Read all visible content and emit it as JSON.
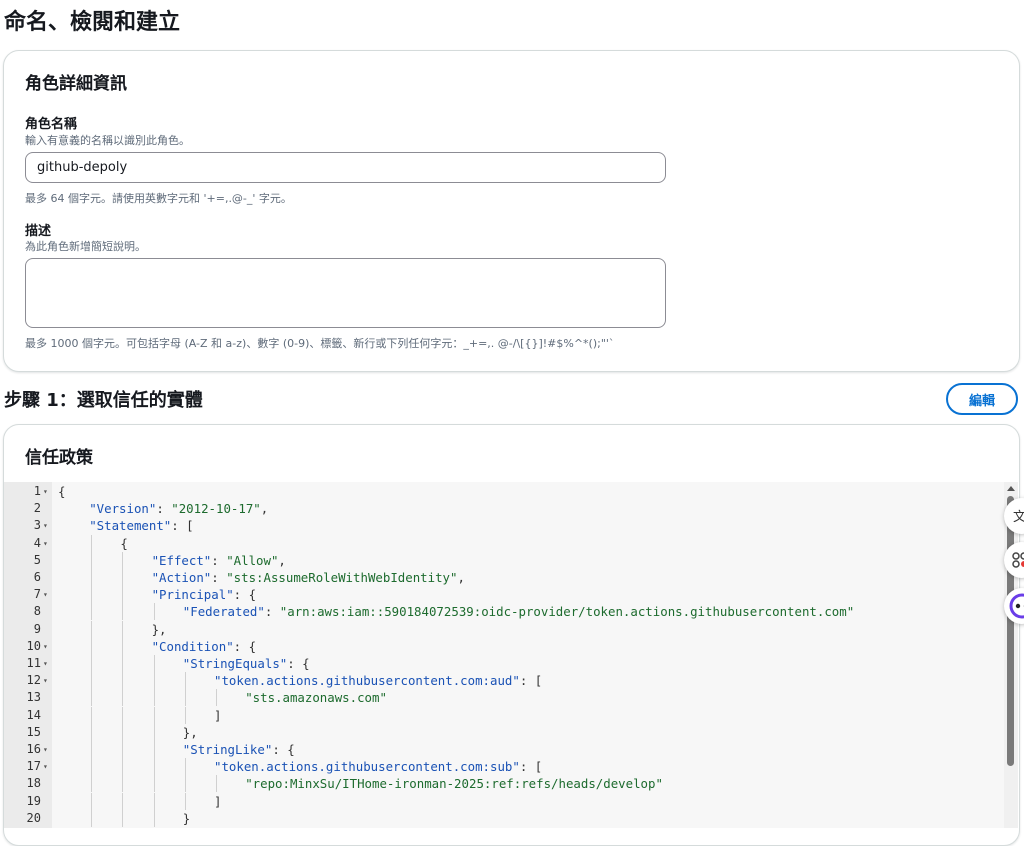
{
  "page_title": "命名、檢閱和建立",
  "role_details": {
    "title": "角色詳細資訊",
    "name_label": "角色名稱",
    "name_desc": "輸入有意義的名稱以識別此角色。",
    "name_value": "github-depoly",
    "name_constraint": "最多 64 個字元。請使用英數字元和 '+=,.@-_' 字元。",
    "desc_label": "描述",
    "desc_desc": "為此角色新增簡短說明。",
    "desc_value": "",
    "desc_constraint": "最多 1000 個字元。可包括字母 (A-Z 和 a-z)、數字 (0-9)、標籤、新行或下列任何字元：_+=,. @-/\\[{}]!#$%^*();\"'`"
  },
  "step1": {
    "heading": "步驟 1：選取信任的實體",
    "edit_label": "編輯"
  },
  "trust_policy": {
    "title": "信任政策",
    "lines": [
      {
        "n": "1",
        "fold": true,
        "indent": 0,
        "segs": [
          {
            "t": "p",
            "v": "{"
          }
        ]
      },
      {
        "n": "2",
        "fold": false,
        "indent": 1,
        "segs": [
          {
            "t": "k",
            "v": "\"Version\""
          },
          {
            "t": "p",
            "v": ": "
          },
          {
            "t": "s",
            "v": "\"2012-10-17\""
          },
          {
            "t": "p",
            "v": ","
          }
        ]
      },
      {
        "n": "3",
        "fold": true,
        "indent": 1,
        "segs": [
          {
            "t": "k",
            "v": "\"Statement\""
          },
          {
            "t": "p",
            "v": ": ["
          }
        ]
      },
      {
        "n": "4",
        "fold": true,
        "indent": 2,
        "segs": [
          {
            "t": "p",
            "v": "{"
          }
        ]
      },
      {
        "n": "5",
        "fold": false,
        "indent": 3,
        "segs": [
          {
            "t": "k",
            "v": "\"Effect\""
          },
          {
            "t": "p",
            "v": ": "
          },
          {
            "t": "s",
            "v": "\"Allow\""
          },
          {
            "t": "p",
            "v": ","
          }
        ]
      },
      {
        "n": "6",
        "fold": false,
        "indent": 3,
        "segs": [
          {
            "t": "k",
            "v": "\"Action\""
          },
          {
            "t": "p",
            "v": ": "
          },
          {
            "t": "s",
            "v": "\"sts:AssumeRoleWithWebIdentity\""
          },
          {
            "t": "p",
            "v": ","
          }
        ]
      },
      {
        "n": "7",
        "fold": true,
        "indent": 3,
        "segs": [
          {
            "t": "k",
            "v": "\"Principal\""
          },
          {
            "t": "p",
            "v": ": {"
          }
        ]
      },
      {
        "n": "8",
        "fold": false,
        "indent": 4,
        "segs": [
          {
            "t": "k",
            "v": "\"Federated\""
          },
          {
            "t": "p",
            "v": ": "
          },
          {
            "t": "s",
            "v": "\"arn:aws:iam::590184072539:oidc-provider/token.actions.githubusercontent.com\""
          }
        ]
      },
      {
        "n": "9",
        "fold": false,
        "indent": 3,
        "segs": [
          {
            "t": "p",
            "v": "},"
          }
        ]
      },
      {
        "n": "10",
        "fold": true,
        "indent": 3,
        "segs": [
          {
            "t": "k",
            "v": "\"Condition\""
          },
          {
            "t": "p",
            "v": ": {"
          }
        ]
      },
      {
        "n": "11",
        "fold": true,
        "indent": 4,
        "segs": [
          {
            "t": "k",
            "v": "\"StringEquals\""
          },
          {
            "t": "p",
            "v": ": {"
          }
        ]
      },
      {
        "n": "12",
        "fold": true,
        "indent": 5,
        "segs": [
          {
            "t": "k",
            "v": "\"token.actions.githubusercontent.com:aud\""
          },
          {
            "t": "p",
            "v": ": ["
          }
        ]
      },
      {
        "n": "13",
        "fold": false,
        "indent": 6,
        "segs": [
          {
            "t": "s",
            "v": "\"sts.amazonaws.com\""
          }
        ]
      },
      {
        "n": "14",
        "fold": false,
        "indent": 5,
        "segs": [
          {
            "t": "p",
            "v": "]"
          }
        ]
      },
      {
        "n": "15",
        "fold": false,
        "indent": 4,
        "segs": [
          {
            "t": "p",
            "v": "},"
          }
        ]
      },
      {
        "n": "16",
        "fold": true,
        "indent": 4,
        "segs": [
          {
            "t": "k",
            "v": "\"StringLike\""
          },
          {
            "t": "p",
            "v": ": {"
          }
        ]
      },
      {
        "n": "17",
        "fold": true,
        "indent": 5,
        "segs": [
          {
            "t": "k",
            "v": "\"token.actions.githubusercontent.com:sub\""
          },
          {
            "t": "p",
            "v": ": ["
          }
        ]
      },
      {
        "n": "18",
        "fold": false,
        "indent": 6,
        "segs": [
          {
            "t": "s",
            "v": "\"repo:MinxSu/ITHome-ironman-2025:ref:refs/heads/develop\""
          }
        ]
      },
      {
        "n": "19",
        "fold": false,
        "indent": 5,
        "segs": [
          {
            "t": "p",
            "v": "]"
          }
        ]
      },
      {
        "n": "20",
        "fold": false,
        "indent": 4,
        "segs": [
          {
            "t": "p",
            "v": "}"
          }
        ]
      }
    ]
  },
  "colors": {
    "accent": "#0972d3",
    "json_key": "#1a52b5",
    "json_string": "#1d6b2e"
  }
}
